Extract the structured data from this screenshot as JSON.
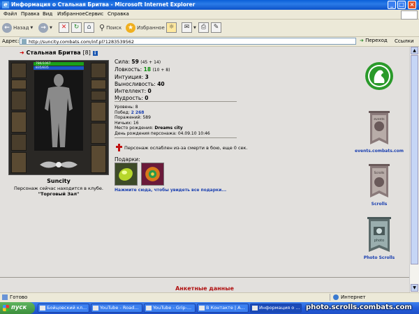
{
  "window": {
    "title": "Информация о Стальная Бритва - Microsoft Internet Explorer"
  },
  "menu": [
    "Файл",
    "Правка",
    "Вид",
    "Избранное",
    "Сервис",
    "Справка"
  ],
  "toolbar": {
    "back": "Назад",
    "search": "Поиск",
    "favorites": "Избранное"
  },
  "address": {
    "label": "Адрес:",
    "url": "http://suncity.combats.com/inf.pl?1283539562",
    "go": "Переход",
    "links": "Ссылки"
  },
  "character": {
    "name": "Стальная Бритва",
    "level": "[8]",
    "hp": "786/1067",
    "mp": "835/835",
    "city": "Suncity",
    "location_text": "Персонаж сейчас находится в клубе.",
    "room": "\"Торговый Зал\""
  },
  "stats": [
    {
      "label": "Сила:",
      "value": "59",
      "extra": "(45 + 14)",
      "green": false
    },
    {
      "label": "Ловкость:",
      "value": "18",
      "extra": "(10 + 8)",
      "green": true
    },
    {
      "label": "Интуиция:",
      "value": "3",
      "extra": "",
      "green": false
    },
    {
      "label": "Выносливость:",
      "value": "40",
      "extra": "",
      "green": false
    },
    {
      "label": "Интеллект:",
      "value": "0",
      "extra": "",
      "green": false
    },
    {
      "label": "Мудрость:",
      "value": "0",
      "extra": "",
      "green": false
    }
  ],
  "info": {
    "level_label": "Уровень:",
    "level": "8",
    "wins_label": "Побед:",
    "wins": "2 268",
    "losses_label": "Поражений:",
    "losses": "589",
    "draws_label": "Ничьих:",
    "draws": "16",
    "birthplace_label": "Место рождения:",
    "birthplace": "Dreams city",
    "birthday_label": "День рождения персонажа:",
    "birthday": "04.09.10 10:46"
  },
  "death_note": "Персонаж ослаблен из-за смерти в бою, еще 0 сек.",
  "gifts": {
    "title": "Подарки:",
    "link": "Нажмите сюда, чтобы увидеть все подарки..."
  },
  "banners": [
    "events.combats.com",
    "Scrolls",
    "Photo Scrolls"
  ],
  "banner_texts": [
    "events",
    "Scrolls",
    "photo"
  ],
  "section_title": "Анкетные данные",
  "status": {
    "ready": "Готово",
    "zone": "Интернет"
  },
  "taskbar": {
    "start": "пуск",
    "tasks": [
      "Бойцовский кл...",
      "YouTube - Road...",
      "YouTube - Grip-...",
      "В Контакте | А...",
      "Информация о ..."
    ]
  },
  "watermark": "photo.scrolls.combats.com",
  "colors": {
    "hp": "#1aa01a",
    "mp": "#1c56c8",
    "link": "#1a3fb0",
    "section": "#b01010"
  }
}
